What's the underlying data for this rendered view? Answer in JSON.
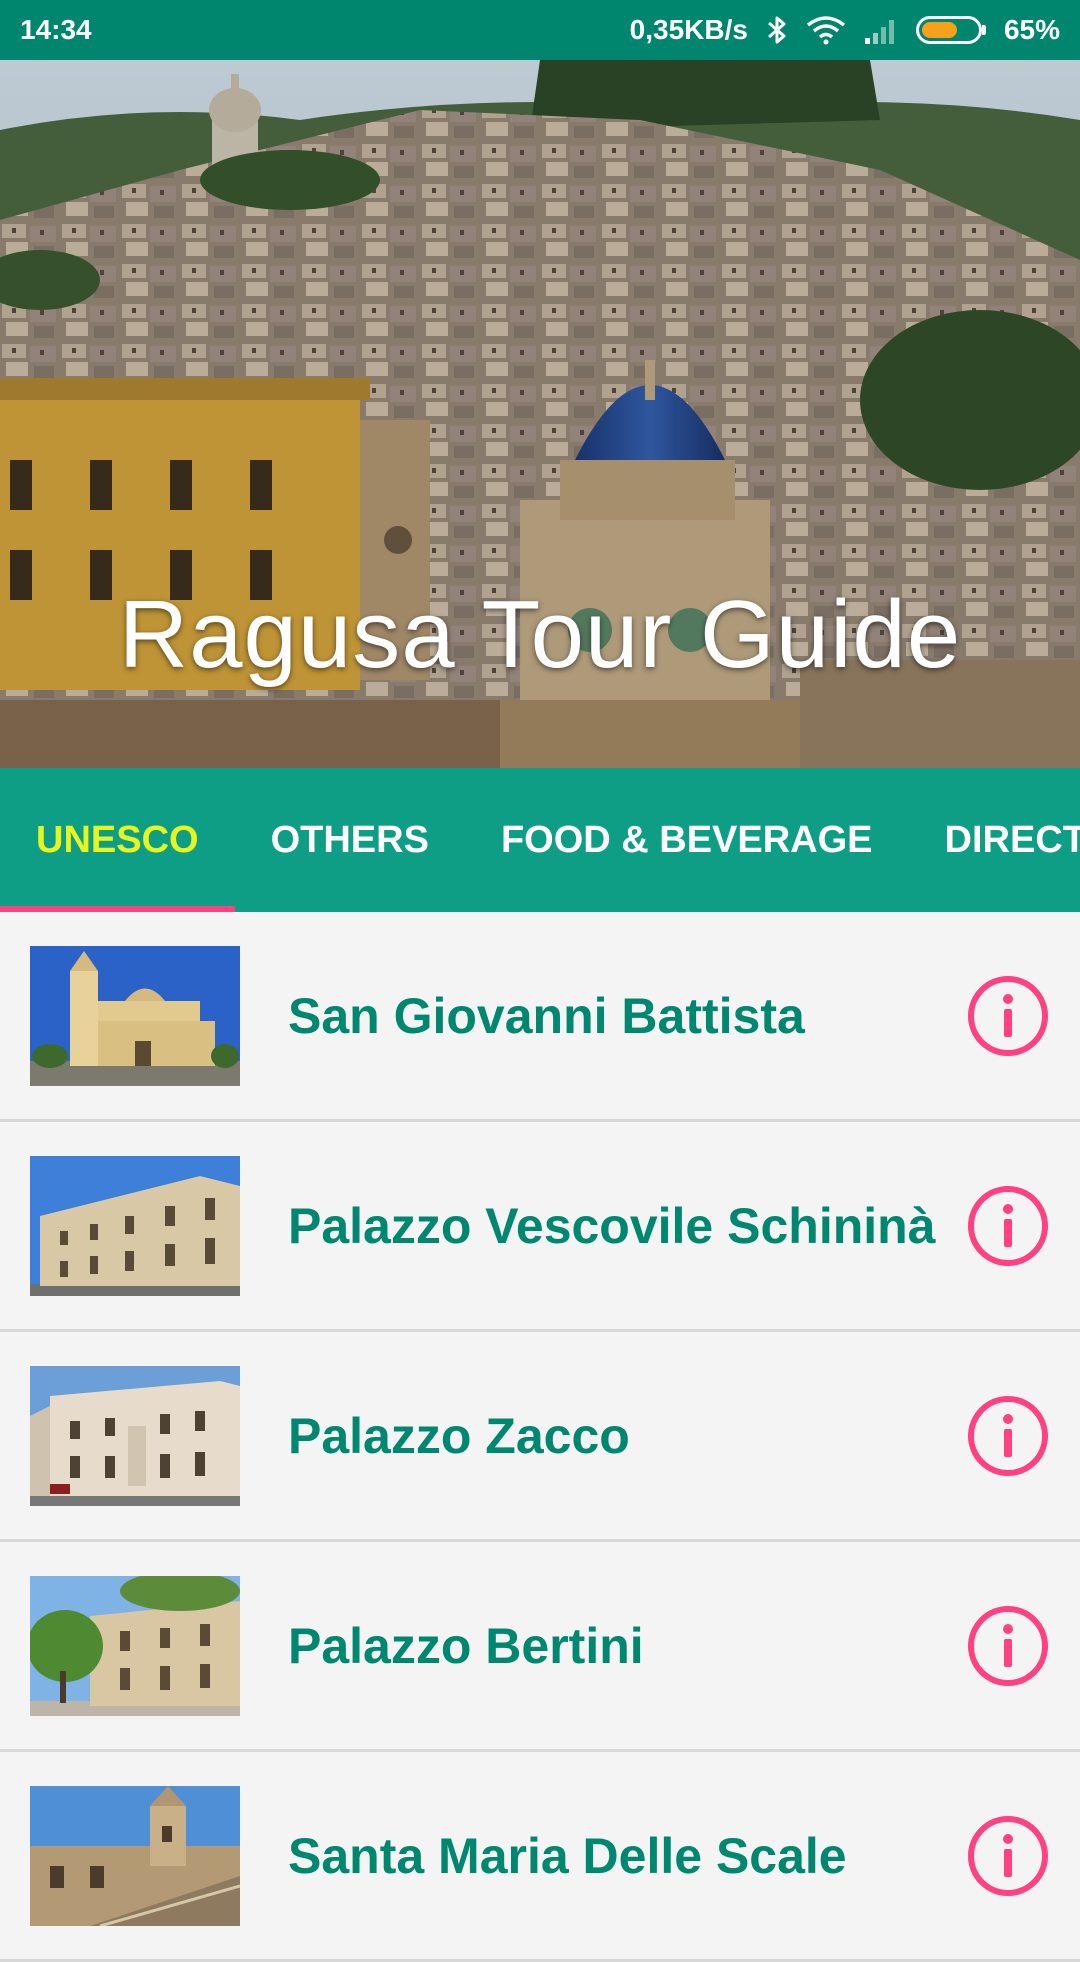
{
  "status_bar": {
    "time": "14:34",
    "network_speed": "0,35KB/s",
    "battery_percent": "65%",
    "battery_level": 0.65,
    "icons": [
      "bluetooth-icon",
      "wifi-icon",
      "signal-icon",
      "battery-icon"
    ]
  },
  "hero": {
    "title": "Ragusa Tour Guide"
  },
  "tabs": [
    {
      "label": "UNESCO",
      "active": true
    },
    {
      "label": "OTHERS",
      "active": false
    },
    {
      "label": "FOOD & BEVERAGE",
      "active": false
    },
    {
      "label": "DIRECT",
      "active": false
    }
  ],
  "items": [
    {
      "title": "San Giovanni Battista"
    },
    {
      "title": "Palazzo Vescovile Schininà"
    },
    {
      "title": "Palazzo Zacco"
    },
    {
      "title": "Palazzo Bertini"
    },
    {
      "title": "Santa Maria Delle Scale"
    }
  ],
  "colors": {
    "status_bar": "#00856f",
    "tab_bar": "#0e9e86",
    "active_tab_text": "#e8f41e",
    "tab_indicator": "#ff4081",
    "item_title": "#00876f",
    "info_icon": "#ff4081",
    "list_background": "#f4f4f4"
  }
}
